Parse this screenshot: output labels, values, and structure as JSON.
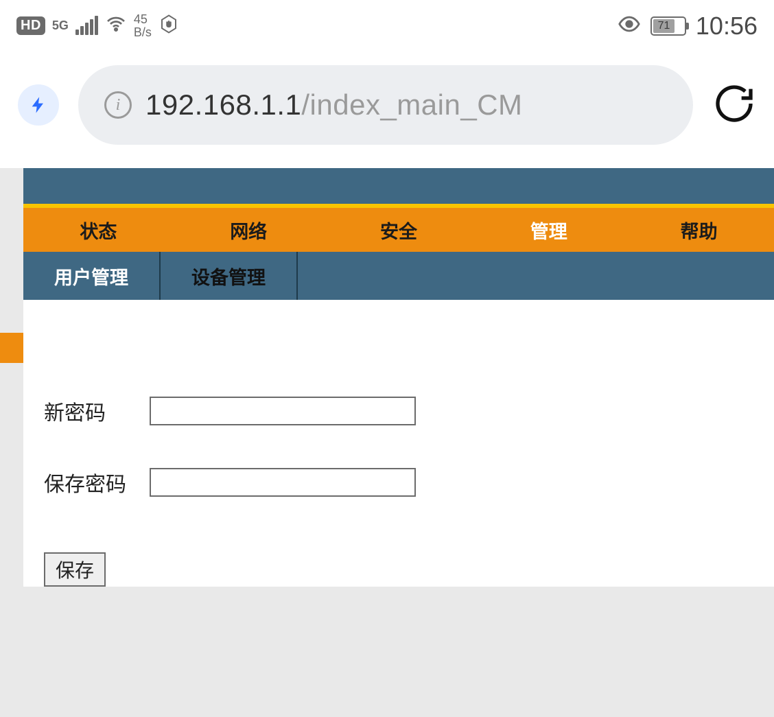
{
  "status": {
    "hd": "HD",
    "net_gen": "5G",
    "speed_num": "45",
    "speed_unit": "B/s",
    "battery_percent": "71",
    "clock": "10:56"
  },
  "browser": {
    "url_host": "192.168.1.1",
    "url_path": "/index_main_CM"
  },
  "nav": {
    "tabs": [
      "状态",
      "网络",
      "安全",
      "管理",
      "帮助"
    ],
    "active_tab": "管理",
    "subtabs": [
      "用户管理",
      "设备管理"
    ],
    "active_subtab": "用户管理"
  },
  "form": {
    "new_password_label": "新密码",
    "confirm_password_label": "保存密码",
    "save_button": "保存"
  }
}
